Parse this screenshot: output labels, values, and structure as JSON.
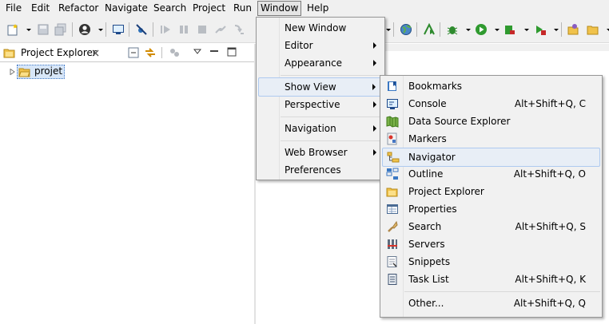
{
  "menubar": {
    "items": [
      "File",
      "Edit",
      "Refactor",
      "Navigate",
      "Search",
      "Project",
      "Run",
      "Window",
      "Help"
    ],
    "active": "Window"
  },
  "project_explorer": {
    "tab_label": "Project Explorer",
    "tree": [
      {
        "label": "projet",
        "expanded": false
      }
    ]
  },
  "window_menu": {
    "new_window": "New Window",
    "editor": "Editor",
    "appearance": "Appearance",
    "show_view": "Show View",
    "perspective": "Perspective",
    "navigation": "Navigation",
    "web_browser": "Web Browser",
    "preferences": "Preferences"
  },
  "show_view_menu": {
    "items": [
      {
        "label": "Bookmarks",
        "accel": "",
        "icon": "bookmarks-icon"
      },
      {
        "label": "Console",
        "accel": "Alt+Shift+Q, C",
        "icon": "console-icon"
      },
      {
        "label": "Data Source Explorer",
        "accel": "",
        "icon": "data-source-icon"
      },
      {
        "label": "Markers",
        "accel": "",
        "icon": "markers-icon"
      },
      {
        "label": "Navigator",
        "accel": "",
        "icon": "navigator-icon"
      },
      {
        "label": "Outline",
        "accel": "Alt+Shift+Q, O",
        "icon": "outline-icon"
      },
      {
        "label": "Project Explorer",
        "accel": "",
        "icon": "project-explorer-icon"
      },
      {
        "label": "Properties",
        "accel": "",
        "icon": "properties-icon"
      },
      {
        "label": "Search",
        "accel": "Alt+Shift+Q, S",
        "icon": "search-icon"
      },
      {
        "label": "Servers",
        "accel": "",
        "icon": "servers-icon"
      },
      {
        "label": "Snippets",
        "accel": "",
        "icon": "snippets-icon"
      },
      {
        "label": "Task List",
        "accel": "Alt+Shift+Q, K",
        "icon": "task-list-icon"
      }
    ],
    "other": {
      "label": "Other...",
      "accel": "Alt+Shift+Q, Q"
    },
    "highlighted": "Navigator"
  }
}
